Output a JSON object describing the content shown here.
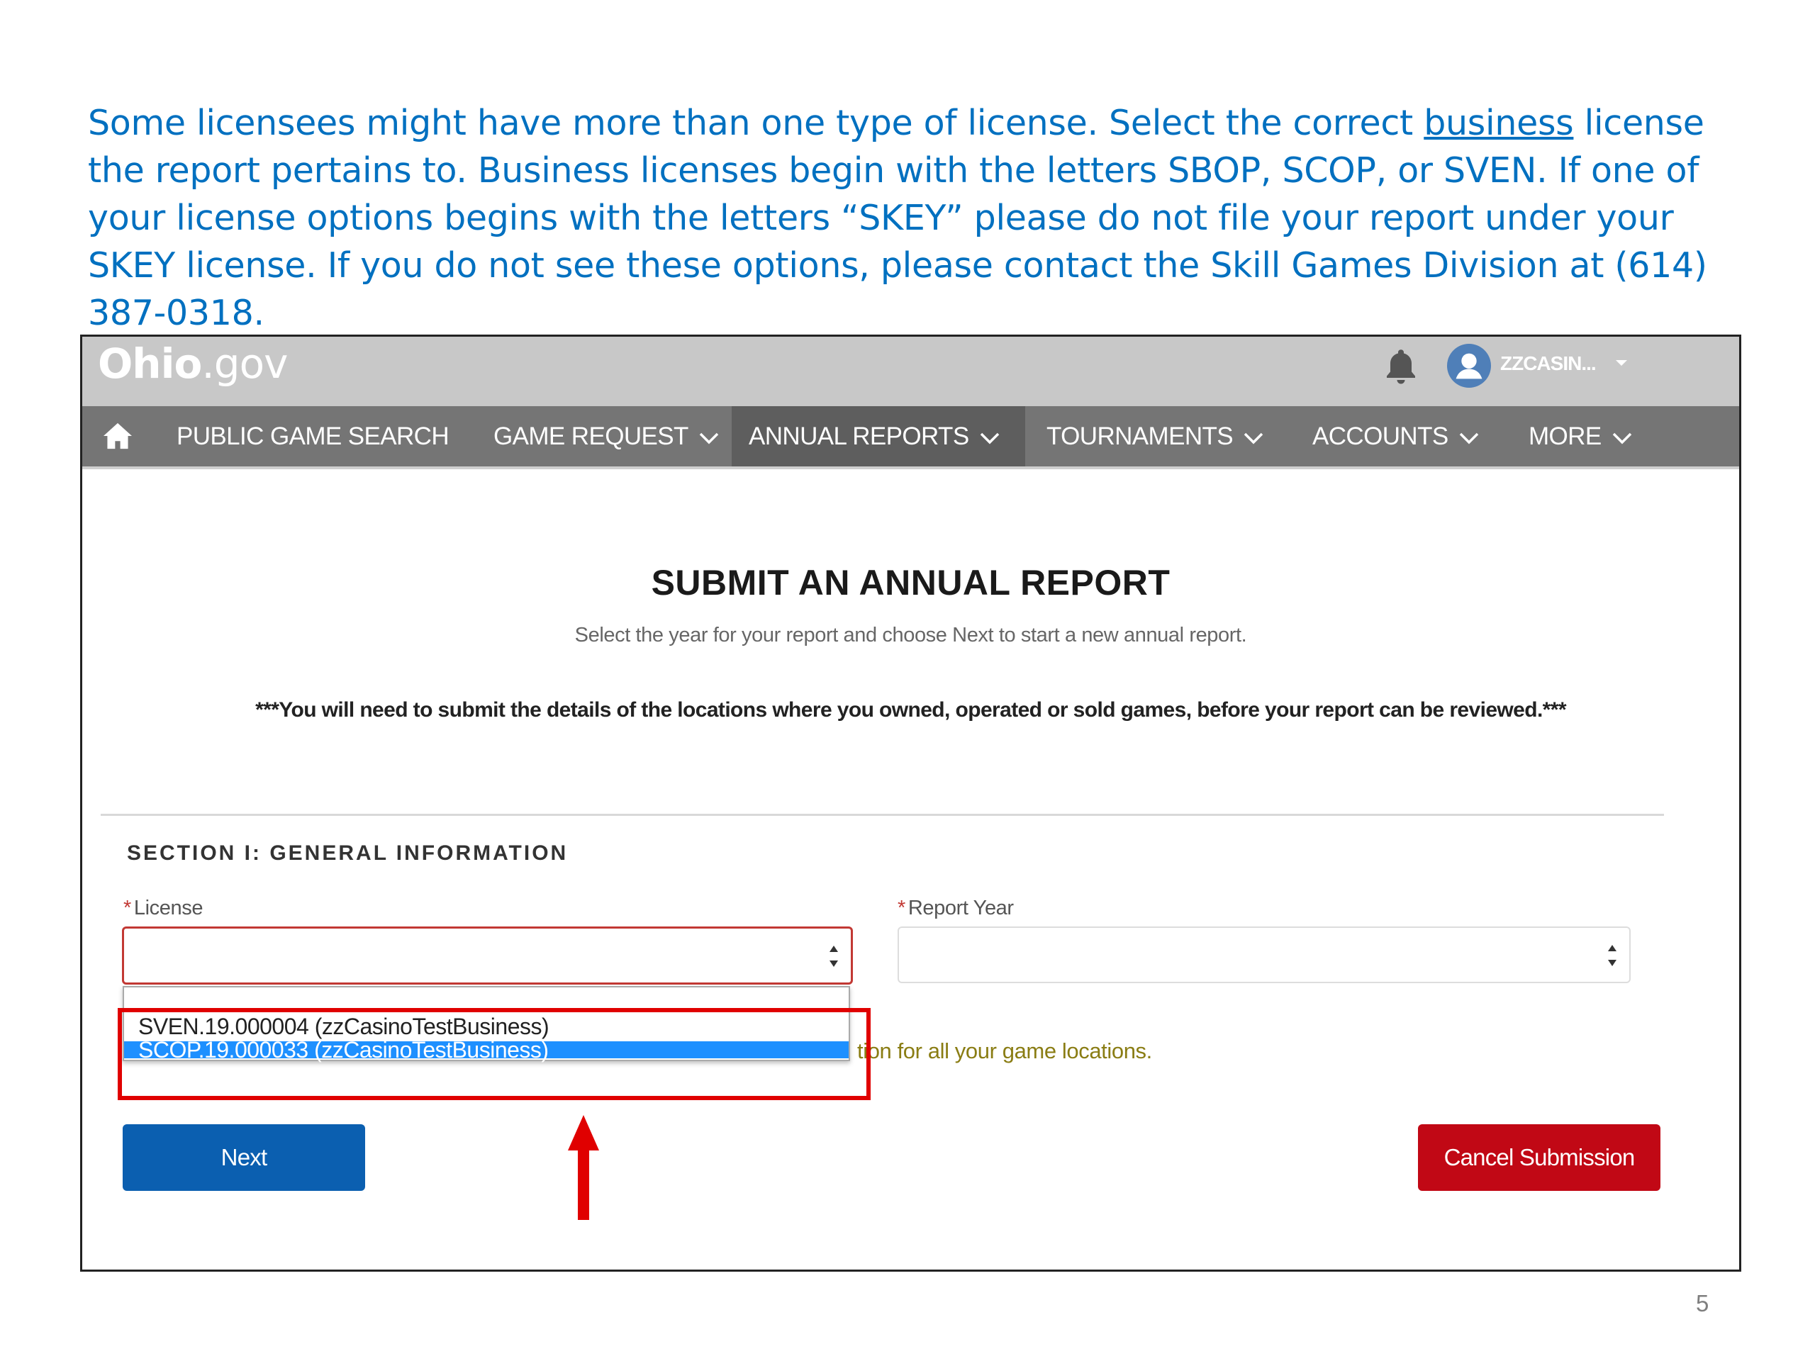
{
  "intro": {
    "part1": "Some licensees might have more than one type of license.  Select the correct ",
    "underlined": "business",
    "part2": " license the report pertains to. Business licenses begin with the letters SBOP, SCOP, or SVEN.  If one of your license options begins with the letters “SKEY” please do not file your report under your SKEY license.  If you do not see these options, please contact the Skill Games Division at (614) 387-0318."
  },
  "header": {
    "logo_main": "Ohio",
    "logo_suffix": ".gov",
    "username": "ZZCASIN..."
  },
  "nav": {
    "items": [
      {
        "label": "PUBLIC GAME SEARCH",
        "has_menu": false
      },
      {
        "label": "GAME REQUEST",
        "has_menu": true
      },
      {
        "label": "ANNUAL REPORTS",
        "has_menu": true,
        "active": true
      },
      {
        "label": "TOURNAMENTS",
        "has_menu": true
      },
      {
        "label": "ACCOUNTS",
        "has_menu": true
      },
      {
        "label": "MORE",
        "has_menu": true
      }
    ]
  },
  "main": {
    "title": "SUBMIT AN ANNUAL REPORT",
    "subtitle": "Select the year for your report and choose Next to start a new annual report.",
    "notice": "***You will need to submit the details of the locations where you owned, operated or sold games, before your report can be reviewed.***",
    "section_title": "SECTION I: GENERAL INFORMATION",
    "required_mark": "*",
    "license_label": "License",
    "report_year_label": "Report Year",
    "license_options": [
      "SVEN.19.000004 (zzCasinoTestBusiness)",
      "SCOP.19.000033 (zzCasinoTestBusiness)"
    ],
    "hint_text": "tion for all your game locations.",
    "next_label": "Next",
    "cancel_label": "Cancel Submission"
  },
  "page_number": "5",
  "colors": {
    "intro_text": "#0070c0",
    "nav_bg": "#757575",
    "nav_active": "#5e5e5e",
    "next_button": "#0b5fb0",
    "cancel_button": "#c10815",
    "callout": "#e00000",
    "selected_option": "#1e90ff",
    "hint_text": "#8a7d14"
  }
}
